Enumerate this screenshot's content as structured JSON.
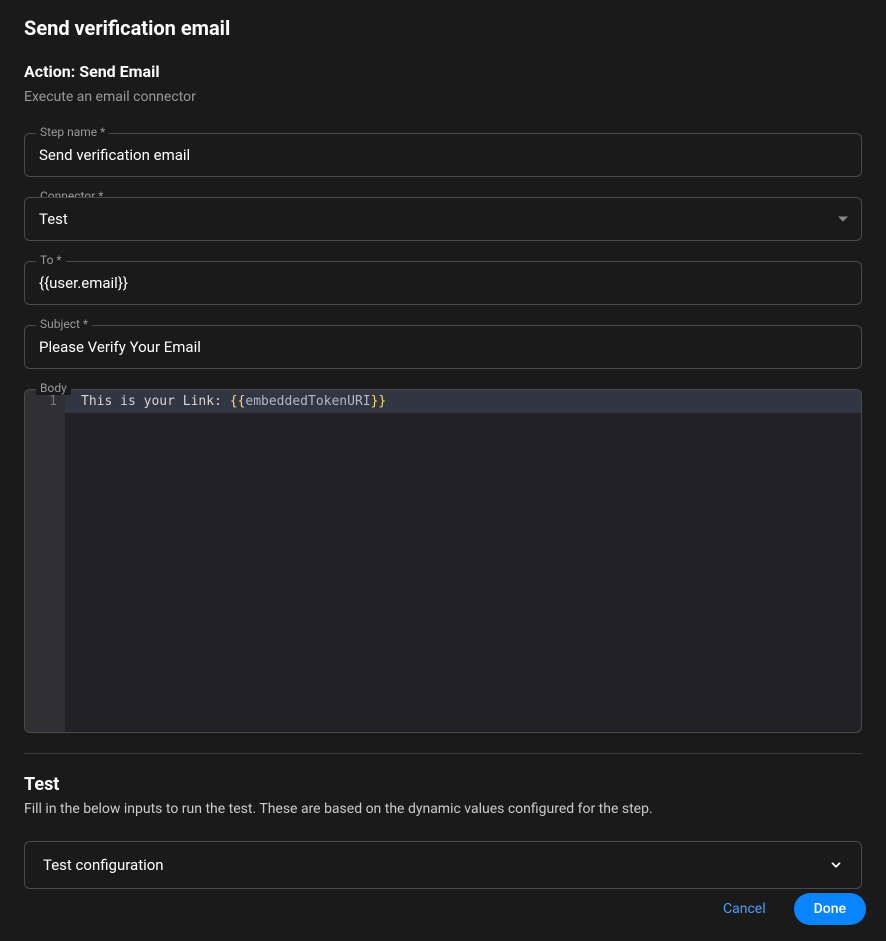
{
  "header": {
    "title": "Send verification email"
  },
  "action": {
    "title": "Action: Send Email",
    "description": "Execute an email connector"
  },
  "fields": {
    "step_name": {
      "label": "Step name *",
      "value": "Send verification email"
    },
    "connector": {
      "label": "Connector *",
      "value": "Test"
    },
    "to": {
      "label": "To *",
      "value": "{{user.email}}"
    },
    "subject": {
      "label": "Subject *",
      "value": "Please Verify Your Email"
    },
    "body": {
      "label": "Body",
      "line_number": "1",
      "code_prefix": "This is your Link: ",
      "code_brace_open": "{{",
      "code_variable": "embeddedTokenURI",
      "code_brace_close": "}}"
    }
  },
  "test_section": {
    "title": "Test",
    "description": "Fill in the below inputs to run the test. These are based on the dynamic values configured for the step.",
    "accordion_label": "Test configuration"
  },
  "footer": {
    "cancel": "Cancel",
    "done": "Done"
  }
}
